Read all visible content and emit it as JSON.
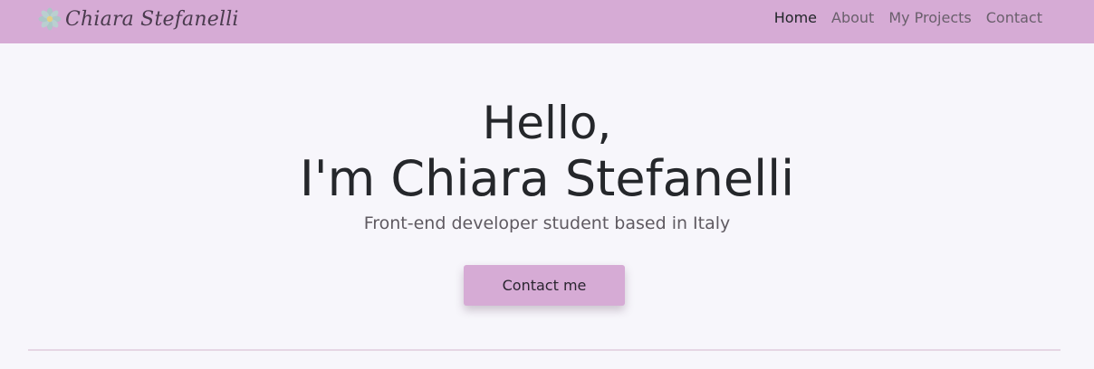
{
  "colors": {
    "navbar_bg": "#d6abd5",
    "page_bg": "#f7f6fb",
    "text_dark": "#25272b",
    "text_muted": "#6a5f6c",
    "button_bg": "#d6abd5"
  },
  "navbar": {
    "brand": {
      "icon": "flower-icon",
      "text": "Chiara Stefanelli"
    },
    "links": [
      {
        "label": "Home",
        "active": true
      },
      {
        "label": "About",
        "active": false
      },
      {
        "label": "My Projects",
        "active": false
      },
      {
        "label": "Contact",
        "active": false
      }
    ]
  },
  "hero": {
    "greeting": "Hello,",
    "name_line": "I'm Chiara Stefanelli",
    "subtitle": "Front-end developer student based in Italy",
    "cta_label": "Contact me"
  }
}
